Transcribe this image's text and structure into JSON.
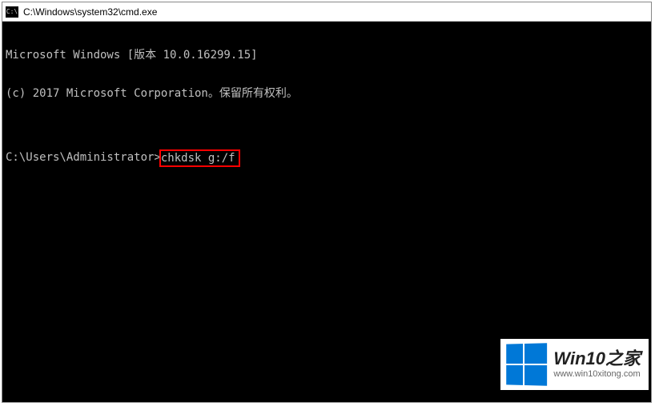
{
  "titlebar": {
    "icon_label": "cmd-icon",
    "title": "C:\\Windows\\system32\\cmd.exe"
  },
  "terminal": {
    "line1": "Microsoft Windows [版本 10.0.16299.15]",
    "line2": "(c) 2017 Microsoft Corporation。保留所有权利。",
    "blank": "",
    "prompt": "C:\\Users\\Administrator>",
    "command": "chkdsk g:/f"
  },
  "watermark": {
    "title": "Win10之家",
    "url": "www.win10xitong.com"
  }
}
